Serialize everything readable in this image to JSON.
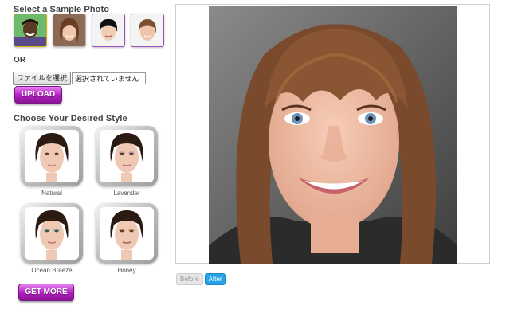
{
  "sample": {
    "heading": "Select a Sample Photo"
  },
  "or_label": "OR",
  "file": {
    "button_label": "ファイルを選択",
    "status": "選択されていません"
  },
  "upload_label": "UPLOAD",
  "styles": {
    "heading": "Choose Your Desired Style",
    "items": [
      {
        "label": "Natural"
      },
      {
        "label": "Lavender"
      },
      {
        "label": "Ocean Breeze"
      },
      {
        "label": "Honey"
      }
    ]
  },
  "get_more_label": "GET MORE",
  "toggle": {
    "before": "Before",
    "after": "After",
    "selected": "After"
  },
  "colors": {
    "accent_purple": "#b01fc0",
    "toggle_blue": "#29a3e8"
  }
}
